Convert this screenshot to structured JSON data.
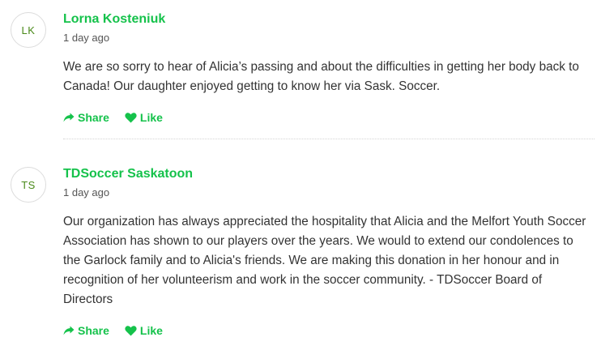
{
  "colors": {
    "accent": "#15c24b",
    "avatar_text": "#4a8a1a",
    "body_text": "#333333",
    "meta_text": "#555555"
  },
  "comments": [
    {
      "avatar_initials": "LK",
      "author": "Lorna Kosteniuk",
      "time": "1 day ago",
      "text": "We are so sorry to hear of Alicia’s passing and about the difficulties in getting her body back to Canada! Our daughter enjoyed getting to know her via Sask. Soccer.",
      "actions": {
        "share_label": "Share",
        "share_icon": "share-arrow-icon",
        "like_label": "Like",
        "like_icon": "heart-icon"
      }
    },
    {
      "avatar_initials": "TS",
      "author": "TDSoccer Saskatoon",
      "time": "1 day ago",
      "text": "Our organization has always appreciated the hospitality that Alicia and the Melfort Youth Soccer Association has shown to our players over the years. We would to extend our condolences to the Garlock family and to Alicia's friends. We are making this donation in her honour and in recognition of her volunteerism and work in the soccer community. - TDSoccer Board of Directors",
      "actions": {
        "share_label": "Share",
        "share_icon": "share-arrow-icon",
        "like_label": "Like",
        "like_icon": "heart-icon"
      }
    }
  ]
}
